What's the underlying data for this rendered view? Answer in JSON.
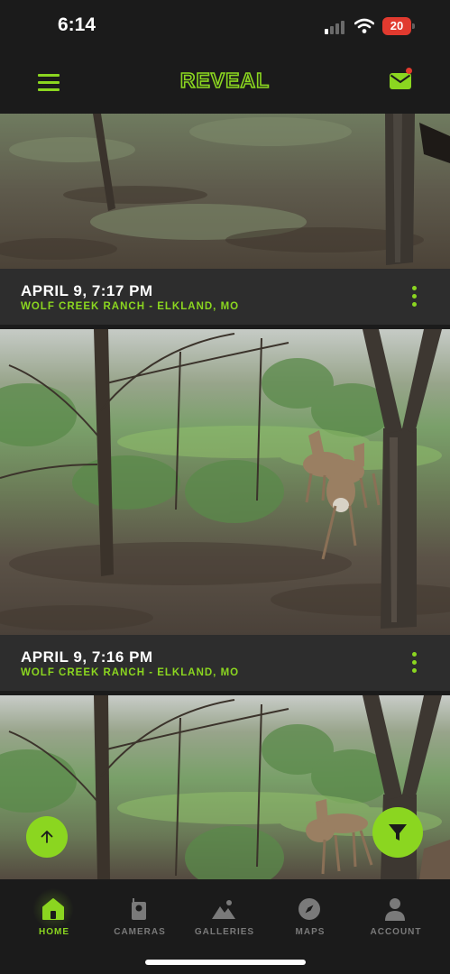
{
  "status_bar": {
    "time": "6:14",
    "battery": "20"
  },
  "header": {
    "title": "REVEAL",
    "menu_icon": "hamburger-menu-icon",
    "inbox_icon": "mail-icon",
    "inbox_badge_color": "#e33b2e"
  },
  "accent_color": "#8bd620",
  "feed": {
    "items": [
      {
        "date": "APRIL 9, 7:17 PM",
        "location": "WOLF CREEK RANCH - ELKLAND, MO"
      },
      {
        "date": "APRIL 9, 7:16 PM",
        "location": "WOLF CREEK RANCH - ELKLAND, MO"
      }
    ]
  },
  "fabs": {
    "scroll_top_icon": "arrow-up-icon",
    "filter_icon": "filter-icon"
  },
  "tabs": [
    {
      "label": "HOME",
      "icon": "home-icon",
      "active": true
    },
    {
      "label": "CAMERAS",
      "icon": "camera-icon",
      "active": false
    },
    {
      "label": "GALLERIES",
      "icon": "gallery-icon",
      "active": false
    },
    {
      "label": "MAPS",
      "icon": "compass-icon",
      "active": false
    },
    {
      "label": "ACCOUNT",
      "icon": "person-icon",
      "active": false
    }
  ]
}
